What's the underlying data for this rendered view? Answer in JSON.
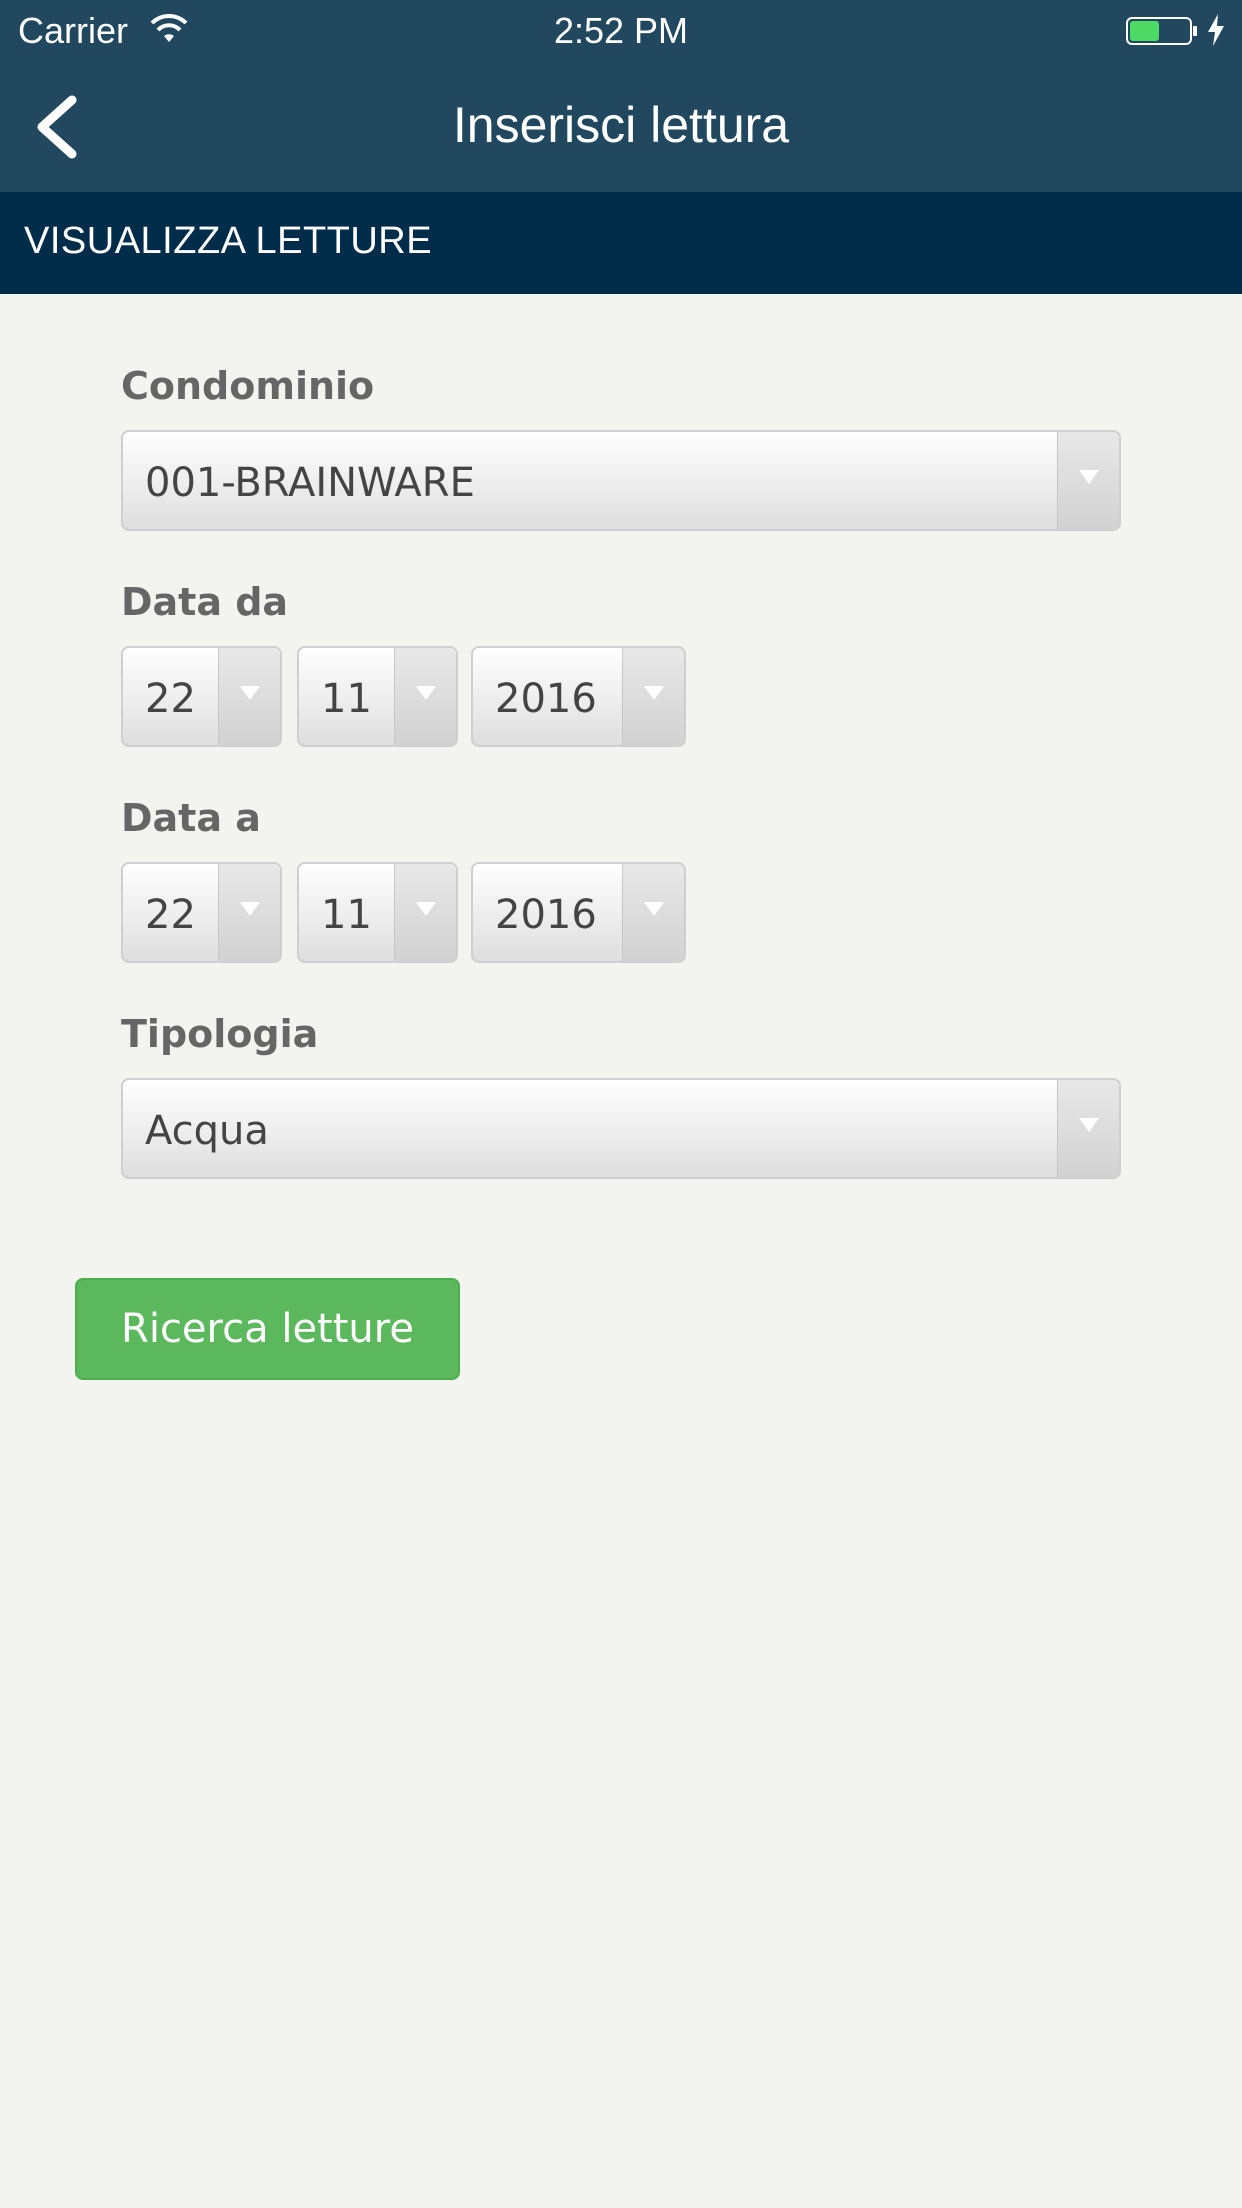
{
  "status_bar": {
    "carrier": "Carrier",
    "time": "2:52 PM",
    "battery_color": "#4cd964"
  },
  "nav_bar": {
    "title": "Inserisci lettura",
    "back_icon": "chevron-left-icon"
  },
  "section": {
    "title": "VISUALIZZA LETTURE"
  },
  "form": {
    "condominio": {
      "label": "Condominio",
      "value": "001-BRAINWARE"
    },
    "data_da": {
      "label": "Data da",
      "day": "22",
      "month": "11",
      "year": "2016"
    },
    "data_a": {
      "label": "Data a",
      "day": "22",
      "month": "11",
      "year": "2016"
    },
    "tipologia": {
      "label": "Tipologia",
      "value": "Acqua"
    },
    "search_button": {
      "label": "Ricerca letture",
      "color": "#5cb85c"
    }
  },
  "colors": {
    "header": "#21485f",
    "section_header": "#022d4a",
    "background": "#f3f3ef"
  }
}
